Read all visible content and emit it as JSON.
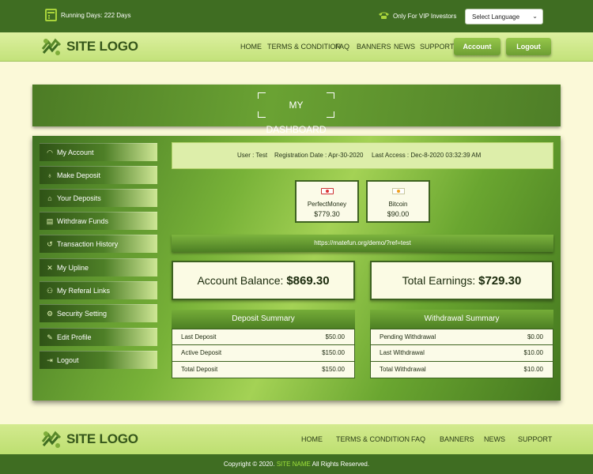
{
  "topbar": {
    "running_days": "Running Days: 222 Days",
    "vip": "Only For VIP Investors",
    "language": "Select Language"
  },
  "header": {
    "logo": "SITE LOGO",
    "nav": [
      "HOME",
      "TERMS & CONDITION",
      "FAQ",
      "BANNERS",
      "NEWS",
      "SUPPORT"
    ],
    "account_button": "Account",
    "logout_button": "Logout"
  },
  "dashboard": {
    "title": "MY DASHBOARD"
  },
  "sidebar": {
    "items": [
      {
        "label": "My Account",
        "icon": "dashboard-icon"
      },
      {
        "label": "Make Deposit",
        "icon": "money-bag-icon"
      },
      {
        "label": "Your Deposits",
        "icon": "bank-icon"
      },
      {
        "label": "Withdraw Funds",
        "icon": "withdraw-icon"
      },
      {
        "label": "Transaction History",
        "icon": "history-icon"
      },
      {
        "label": "My Upline",
        "icon": "upline-icon"
      },
      {
        "label": "My Referal Links",
        "icon": "link-icon"
      },
      {
        "label": "Security Setting",
        "icon": "gear-icon"
      },
      {
        "label": "Edit Profile",
        "icon": "edit-icon"
      },
      {
        "label": "Logout",
        "icon": "logout-icon"
      }
    ]
  },
  "info": {
    "user": "User : Test",
    "registration": "Registration Date : Apr-30-2020",
    "last_access": "Last Access : Dec-8-2020 03:32:39 AM"
  },
  "payments": [
    {
      "name": "PerfectMoney",
      "amount": "$779.30",
      "icon": "perfectmoney-icon"
    },
    {
      "name": "Bitcoin",
      "amount": "$90.00",
      "icon": "bitcoin-icon"
    }
  ],
  "referral_link": "https://matefun.org/demo/?ref=test",
  "balances": {
    "account_label": "Account Balance:",
    "account_value": "$869.30",
    "earnings_label": "Total Earnings:",
    "earnings_value": "$729.30"
  },
  "deposit_summary": {
    "title": "Deposit Summary",
    "rows": [
      {
        "label": "Last Deposit",
        "value": "$50.00"
      },
      {
        "label": "Active Deposit",
        "value": "$150.00"
      },
      {
        "label": "Total Deposit",
        "value": "$150.00"
      }
    ]
  },
  "withdrawal_summary": {
    "title": "Withdrawal Summary",
    "rows": [
      {
        "label": "Pending Withdrawal",
        "value": "$0.00"
      },
      {
        "label": "Last Withdrawal",
        "value": "$10.00"
      },
      {
        "label": "Total Withdrawal",
        "value": "$10.00"
      }
    ]
  },
  "footer": {
    "logo": "SITE LOGO",
    "nav": [
      "HOME",
      "TERMS & CONDITION",
      "FAQ",
      "BANNERS",
      "NEWS",
      "SUPPORT"
    ],
    "copyright_prefix": "Copyright © 2020.",
    "site_name": "SITE NAME",
    "copyright_suffix": "All Rights Reserved."
  },
  "colors": {
    "dark_green": "#3f6d22",
    "light_green": "#c3e27a",
    "accent": "#9fe23a",
    "cream": "#fbf9d8"
  }
}
